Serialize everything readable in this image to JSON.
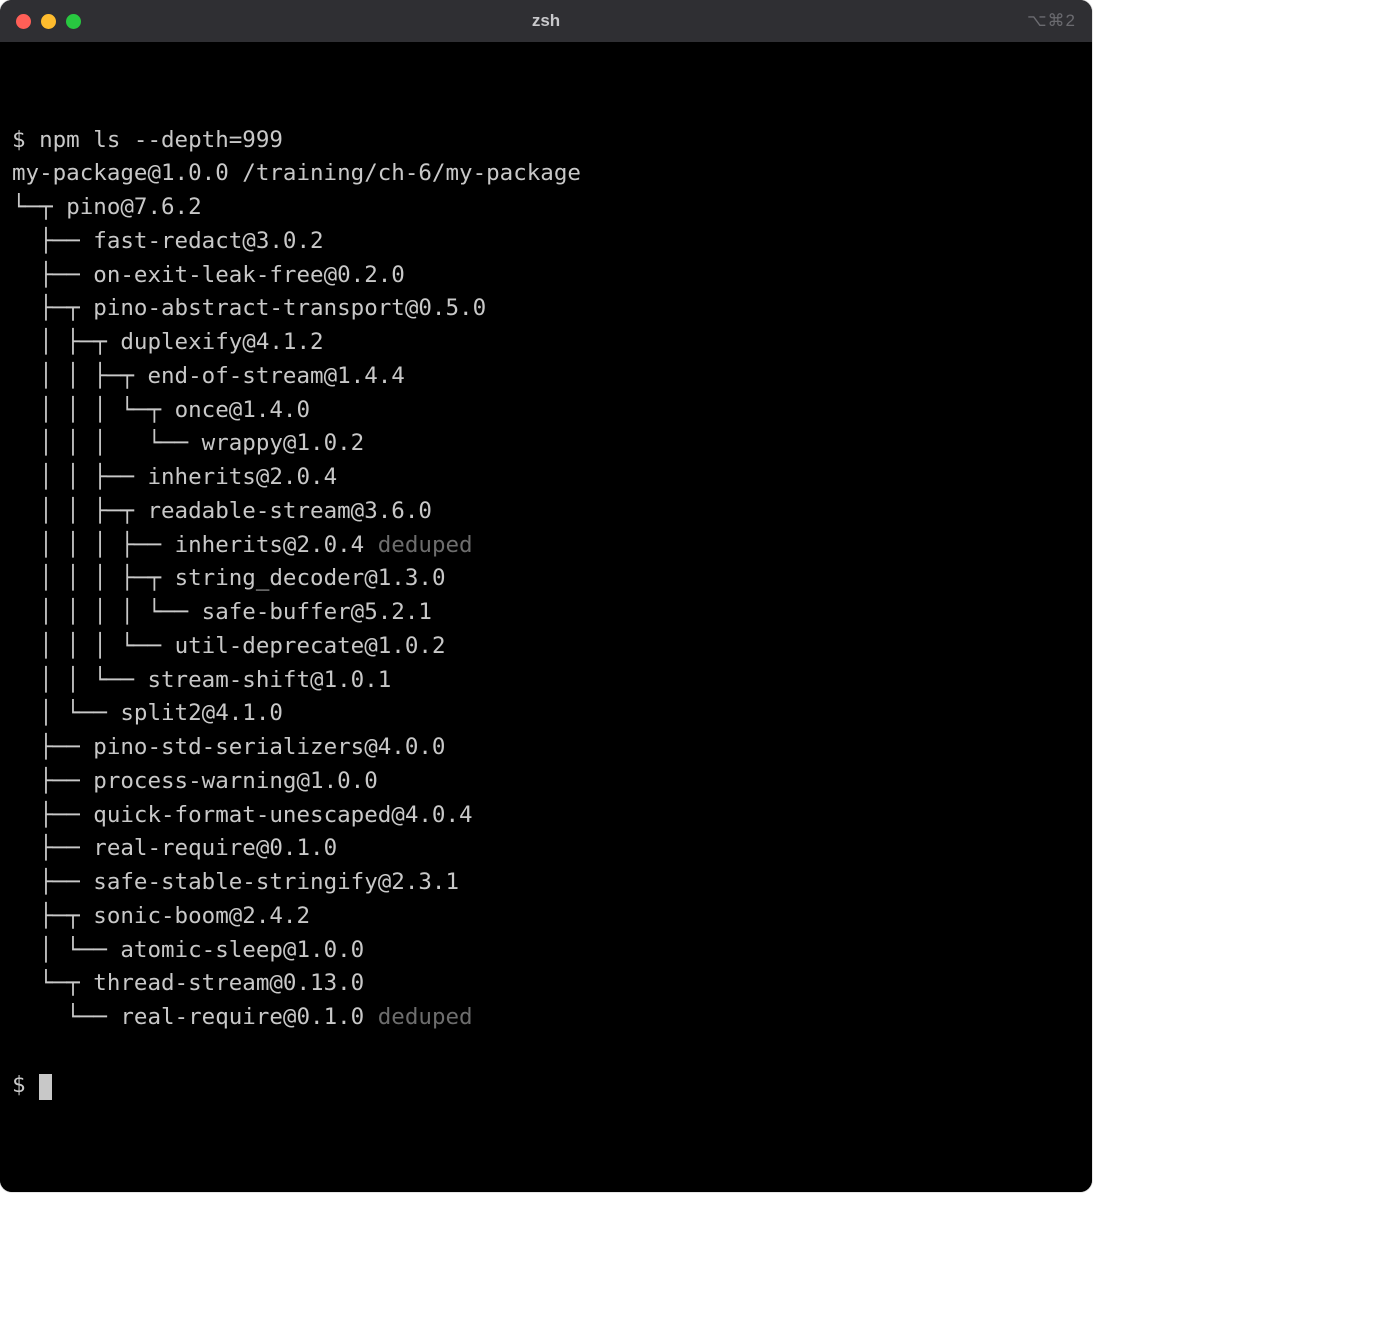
{
  "window": {
    "title": "zsh",
    "right_indicator": "⌥⌘2"
  },
  "terminal": {
    "prompt_symbol": "$",
    "command": "npm ls --depth=999",
    "root_line": "my-package@1.0.0 /training/ch-6/my-package",
    "tree_lines": [
      {
        "prefix": "└─┬ ",
        "pkg": "pino@7.6.2",
        "deduped": false
      },
      {
        "prefix": "  ├── ",
        "pkg": "fast-redact@3.0.2",
        "deduped": false
      },
      {
        "prefix": "  ├── ",
        "pkg": "on-exit-leak-free@0.2.0",
        "deduped": false
      },
      {
        "prefix": "  ├─┬ ",
        "pkg": "pino-abstract-transport@0.5.0",
        "deduped": false
      },
      {
        "prefix": "  │ ├─┬ ",
        "pkg": "duplexify@4.1.2",
        "deduped": false
      },
      {
        "prefix": "  │ │ ├─┬ ",
        "pkg": "end-of-stream@1.4.4",
        "deduped": false
      },
      {
        "prefix": "  │ │ │ └─┬ ",
        "pkg": "once@1.4.0",
        "deduped": false
      },
      {
        "prefix": "  │ │ │   └── ",
        "pkg": "wrappy@1.0.2",
        "deduped": false
      },
      {
        "prefix": "  │ │ ├── ",
        "pkg": "inherits@2.0.4",
        "deduped": false
      },
      {
        "prefix": "  │ │ ├─┬ ",
        "pkg": "readable-stream@3.6.0",
        "deduped": false
      },
      {
        "prefix": "  │ │ │ ├── ",
        "pkg": "inherits@2.0.4",
        "deduped": true
      },
      {
        "prefix": "  │ │ │ ├─┬ ",
        "pkg": "string_decoder@1.3.0",
        "deduped": false
      },
      {
        "prefix": "  │ │ │ │ └── ",
        "pkg": "safe-buffer@5.2.1",
        "deduped": false
      },
      {
        "prefix": "  │ │ │ └── ",
        "pkg": "util-deprecate@1.0.2",
        "deduped": false
      },
      {
        "prefix": "  │ │ └── ",
        "pkg": "stream-shift@1.0.1",
        "deduped": false
      },
      {
        "prefix": "  │ └── ",
        "pkg": "split2@4.1.0",
        "deduped": false
      },
      {
        "prefix": "  ├── ",
        "pkg": "pino-std-serializers@4.0.0",
        "deduped": false
      },
      {
        "prefix": "  ├── ",
        "pkg": "process-warning@1.0.0",
        "deduped": false
      },
      {
        "prefix": "  ├── ",
        "pkg": "quick-format-unescaped@4.0.4",
        "deduped": false
      },
      {
        "prefix": "  ├── ",
        "pkg": "real-require@0.1.0",
        "deduped": false
      },
      {
        "prefix": "  ├── ",
        "pkg": "safe-stable-stringify@2.3.1",
        "deduped": false
      },
      {
        "prefix": "  ├─┬ ",
        "pkg": "sonic-boom@2.4.2",
        "deduped": false
      },
      {
        "prefix": "  │ └── ",
        "pkg": "atomic-sleep@1.0.0",
        "deduped": false
      },
      {
        "prefix": "  └─┬ ",
        "pkg": "thread-stream@0.13.0",
        "deduped": false
      },
      {
        "prefix": "    └── ",
        "pkg": "real-require@0.1.0",
        "deduped": true
      }
    ],
    "deduped_label": "deduped"
  }
}
